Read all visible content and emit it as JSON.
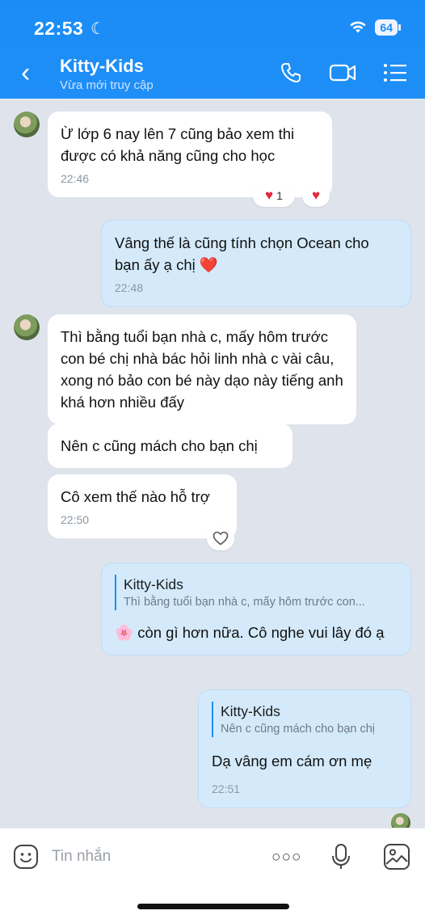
{
  "status": {
    "time": "22:53",
    "moon": "☾",
    "battery": "64"
  },
  "header": {
    "back": "‹",
    "title": "Kitty-Kids",
    "subtitle": "Vừa mới truy cập"
  },
  "messages": {
    "m1": {
      "text": "Ừ lớp 6 nay lên 7 cũng bảo xem thi được có khả năng cũng cho học",
      "time": "22:46",
      "reaction_count": "1"
    },
    "m2": {
      "text": "Vâng thế là cũng tính chọn Ocean cho bạn ấy ạ chị ❤️",
      "time": "22:48"
    },
    "m3": {
      "text": "Thì bằng tuổi bạn nhà c, mấy hôm trước con bé chị nhà bác hỏi linh nhà c vài câu, xong nó bảo con bé này dạo này tiếng anh khá hơn nhiều đấy"
    },
    "m4": {
      "text": "Nên c cũng mách cho bạn chị"
    },
    "m5": {
      "text": "Cô xem thế nào hỗ trợ",
      "time": "22:50"
    },
    "m6": {
      "quote_name": "Kitty-Kids",
      "quote_text": "Thì bằng tuổi bạn nhà c, mấy hôm trước con...",
      "emoji": "🌸",
      "text": "còn gì hơn nữa. Cô nghe vui lây đó ạ"
    },
    "m7": {
      "quote_name": "Kitty-Kids",
      "quote_text": "Nên c cũng mách cho bạn chị",
      "text": "Dạ vâng em cám ơn mẹ",
      "time": "22:51"
    }
  },
  "input": {
    "placeholder": "Tin nhắn",
    "more": "○○○"
  },
  "colors": {
    "header": "#1b8cf6",
    "chat_bg": "#dfe4ec",
    "out_bubble": "#d4eafb",
    "heart": "#e22b3a"
  },
  "icons": [
    "phone-icon",
    "video-call-icon",
    "list-menu-icon",
    "emoji-icon",
    "mic-icon",
    "image-icon",
    "heart-icon"
  ]
}
